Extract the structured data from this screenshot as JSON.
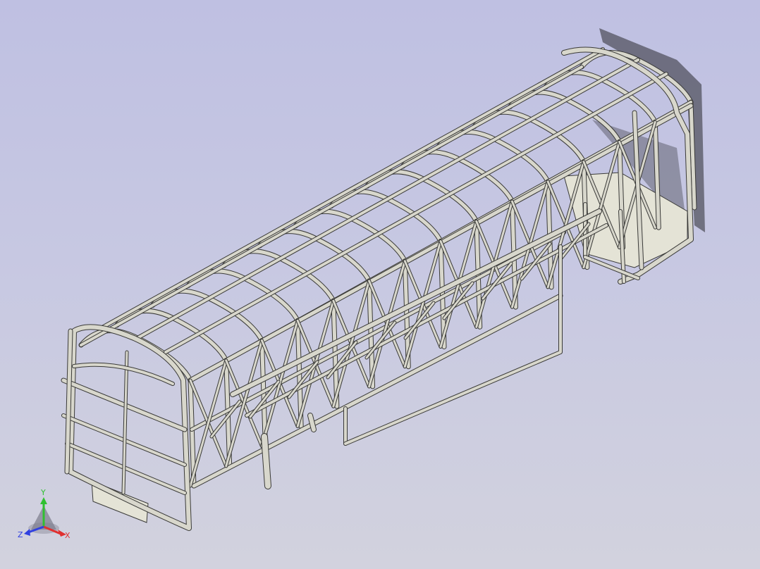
{
  "viewport": {
    "background_top": "#bfc0e2",
    "background_bottom": "#d2d2de"
  },
  "model": {
    "tube_fill": "#d8d7cc",
    "tube_edge": "#3a3a38",
    "panel_fill": "#e4e3d6",
    "shadow_color": "#2a2a30"
  },
  "triad": {
    "x_label": "X",
    "y_label": "Y",
    "z_label": "Z",
    "x_color": "#e03030",
    "y_color": "#30c030",
    "z_color": "#3040e0"
  }
}
